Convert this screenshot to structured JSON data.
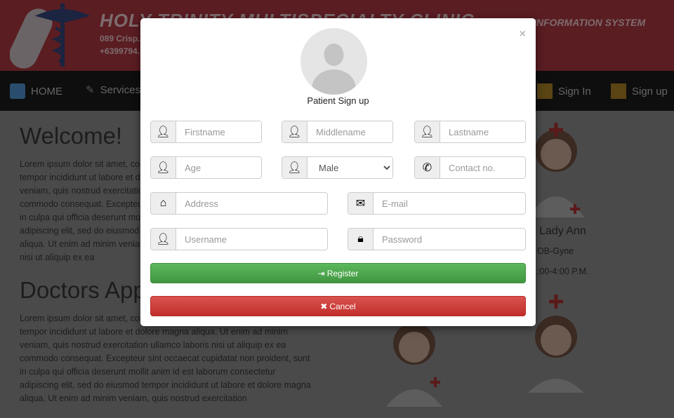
{
  "header": {
    "clinic_name": "HOLY TRINITY MULTISPECIALTY CLINIC",
    "subtitle": "INFORMATION SYSTEM",
    "address": "089 Crisp...",
    "phone": "+6399794..."
  },
  "nav": {
    "items": [
      {
        "label": "HOME",
        "icon": "home-icon"
      },
      {
        "label": "Services",
        "icon": "pencil-icon"
      },
      {
        "label": "Sign In",
        "icon": "login-icon"
      },
      {
        "label": "Sign up",
        "icon": "signup-icon"
      }
    ]
  },
  "main": {
    "welcome_title": "Welcome!",
    "welcome_text": "Lorem ipsum dolor sit amet, consectetur adipiscing elit, sed do eiusmod tempor incididunt ut labore et dolore magna aliqua. Ut enim ad minim veniam, quis nostrud exercitation ullamco laboris nisi ut aliquip ex ea commodo consequat. Excepteur sint occaecat cupidatat non proident, sunt in culpa qui officia deserunt mollit anim id est laborum consectetur adipiscing elit, sed do eiusmod tempor incididunt ut labore et dolore magna aliqua. Ut enim ad minim veniam, quis nostrud exercitation ullamco laboris nisi ut aliquip ex ea",
    "doctors_title": "Doctors Appointment",
    "doctors_text": "Lorem ipsum dolor sit amet, consectetur adipiscing elit, sed do eiusmod tempor incididunt ut labore et dolore magna aliqua. Ut enim ad minim veniam, quis nostrud exercitation ullamco laboris nisi ut aliquip ex ea commodo consequat. Excepteur sint occaecat cupidatat non proident, sunt in culpa qui officia deserunt mollit anim id est laborum consectetur adipiscing elit, sed do eiusmod tempor incididunt ut labore et dolore magna aliqua. Ut enim ad minim veniam, quis nostrud exercitation"
  },
  "doctor": {
    "name": "Lady Ann",
    "specialty": "OB-Gyne",
    "schedule": "1:00-4:00 P.M."
  },
  "modal": {
    "title": "Patient Sign up",
    "close": "×",
    "fields": {
      "firstname": "Firstname",
      "middlename": "Middlename",
      "lastname": "Lastname",
      "age": "Age",
      "gender": "Male",
      "contact": "Contact no.",
      "address": "Address",
      "email": "E-mail",
      "username": "Username",
      "password": "Password"
    },
    "register_label": "Register",
    "cancel_label": "Cancel"
  }
}
